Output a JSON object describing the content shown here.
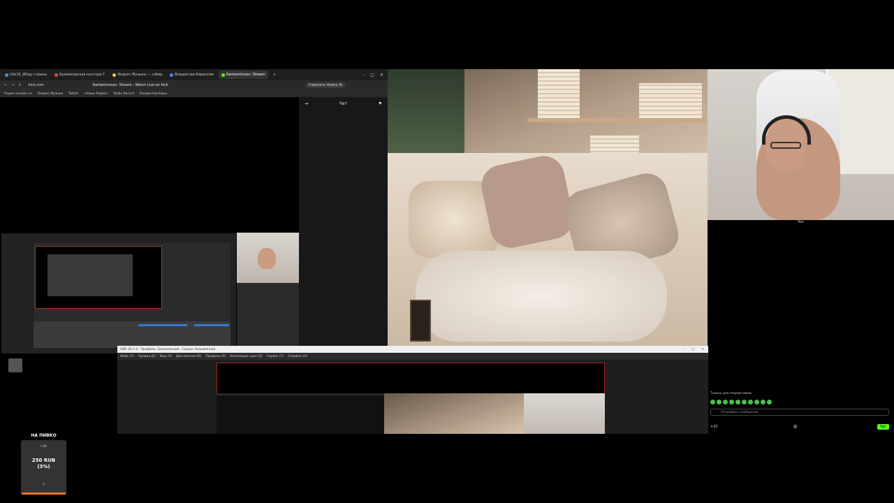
{
  "browser": {
    "tabs": [
      {
        "label": "Ulol15_ИОду страны",
        "color": "#4a90e2"
      },
      {
        "label": "Букмекерская контора Г",
        "color": "#e24a4a"
      },
      {
        "label": "Яндекс Музыка — собир",
        "color": "#f5c542"
      },
      {
        "label": "Владислав Кириллов",
        "color": "#4a90e2"
      },
      {
        "label": "Kantemirovec: Stream",
        "color": "#53fc18",
        "active": true
      }
    ],
    "url": "kick.com",
    "page_title": "Kantemirovec: Stream - Watch Live on Kick",
    "alice_button": "Спросить Алису AI",
    "bookmarks": [
      "Радио онлайн сл",
      "Яндекс Музыка",
      "Twitch",
      "«Наше Радио»",
      "Radio Record",
      "Владислав Кири"
    ],
    "chat_header": "Чат"
  },
  "twitch_chat": {
    "header": "Чат",
    "sub_only": "Только для подписчиков",
    "placeholder": "Отправить сообщение",
    "points": "20",
    "send": "Чат"
  },
  "obs": {
    "title": "OBS 30.2.3 - Профиль: Безымянный - Сцены: Безымянная",
    "menu": [
      "Файл (F)",
      "Правка (E)",
      "Вид (V)",
      "Док-панели (D)",
      "Профиль (P)",
      "Коллекция сцен (S)",
      "Сервис (T)",
      "Справка (H)"
    ]
  },
  "donation": {
    "title": "НА ПИВКО",
    "subtitle": "0.88",
    "amount": "250 RUB",
    "percent": "(3%)",
    "zero": "0"
  },
  "colors": {
    "kick_green": "#53fc18",
    "obs_red": "#b02020",
    "donation_bar": "#e8722a"
  }
}
